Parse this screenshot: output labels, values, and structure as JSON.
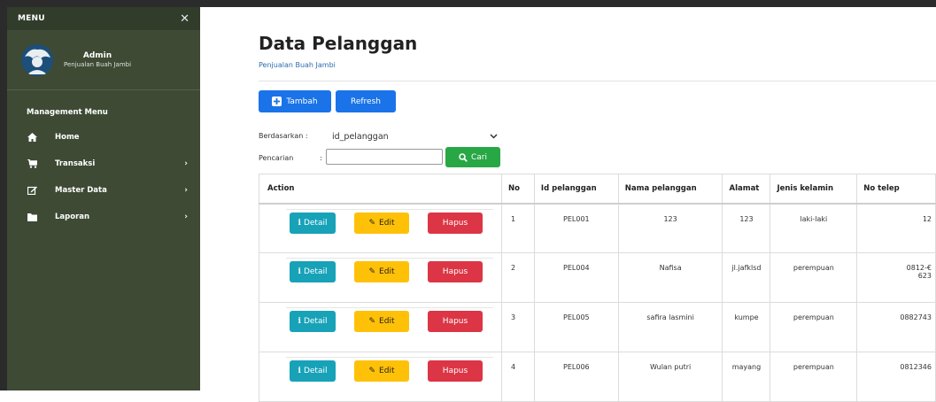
{
  "sidebar": {
    "menu_label": "MENU",
    "close_glyph": "✕",
    "user": {
      "name": "Admin",
      "subtitle": "Penjualan Buah Jambi"
    },
    "section_title": "Management Menu",
    "items": [
      {
        "label": "Home",
        "icon": "home-icon",
        "chevron": ""
      },
      {
        "label": "Transaksi",
        "icon": "cart-icon",
        "chevron": "›"
      },
      {
        "label": "Master Data",
        "icon": "edit-icon",
        "chevron": "›"
      },
      {
        "label": "Laporan",
        "icon": "folder-icon",
        "chevron": "›"
      }
    ]
  },
  "header": {
    "title": "Data Pelanggan",
    "subtitle": "Penjualan Buah Jambi"
  },
  "toolbar": {
    "tambah_label": "Tambah",
    "refresh_label": "Refresh"
  },
  "filter": {
    "berdasarkan_label": "Berdasarkan :",
    "selected": "id_pelanggan",
    "pencarian_label": "Pencarian",
    "pencarian_sep": ":",
    "search_value": "",
    "cari_label": "Cari"
  },
  "table": {
    "columns": [
      "Action",
      "No",
      "Id pelanggan",
      "Nama pelanggan",
      "Alamat",
      "Jenis kelamin",
      "No telep"
    ],
    "action_labels": {
      "detail": "Detail",
      "edit": "Edit",
      "hapus": "Hapus"
    },
    "rows": [
      {
        "no": "1",
        "id": "PEL001",
        "nama": "123",
        "alamat": "123",
        "jk": "laki-laki",
        "telp": "12",
        "telp2": ""
      },
      {
        "no": "2",
        "id": "PEL004",
        "nama": "Nafisa",
        "alamat": "jl.jafklsd",
        "jk": "perempuan",
        "telp": "0812-€",
        "telp2": "623"
      },
      {
        "no": "3",
        "id": "PEL005",
        "nama": "safira lasmini",
        "alamat": "kumpe",
        "jk": "perempuan",
        "telp": "0882743",
        "telp2": ""
      },
      {
        "no": "4",
        "id": "PEL006",
        "nama": "Wulan putri",
        "alamat": "mayang",
        "jk": "perempuan",
        "telp": "0812346",
        "telp2": ""
      }
    ]
  },
  "colors": {
    "sidebar_bg": "#3e4a34",
    "primary": "#1a73e8",
    "success": "#28a745",
    "info": "#17a2b8",
    "warning": "#ffc107",
    "danger": "#dc3545"
  }
}
